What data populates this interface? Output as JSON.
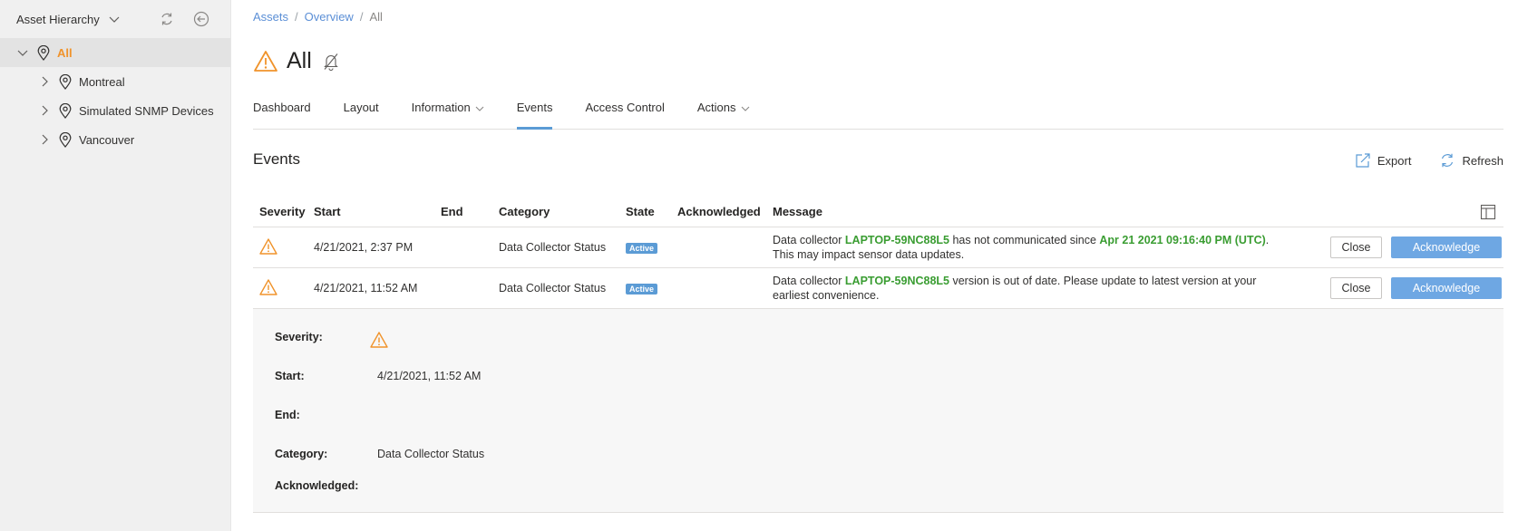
{
  "sidebar": {
    "title": "Asset Hierarchy",
    "tree": [
      {
        "label": "All",
        "selected": true
      },
      {
        "label": "Montreal"
      },
      {
        "label": "Simulated SNMP Devices"
      },
      {
        "label": "Vancouver"
      }
    ]
  },
  "breadcrumb": {
    "items": [
      "Assets",
      "Overview"
    ],
    "sep": "/",
    "current": "All"
  },
  "page": {
    "title": "All"
  },
  "tabs": [
    {
      "label": "Dashboard"
    },
    {
      "label": "Layout"
    },
    {
      "label": "Information",
      "dropdown": true
    },
    {
      "label": "Events",
      "active": true
    },
    {
      "label": "Access Control"
    },
    {
      "label": "Actions",
      "dropdown": true
    }
  ],
  "events": {
    "title": "Events",
    "export_label": "Export",
    "refresh_label": "Refresh",
    "columns": {
      "severity": "Severity",
      "start": "Start",
      "end": "End",
      "category": "Category",
      "state": "State",
      "acknowledged": "Acknowledged",
      "message": "Message"
    },
    "rows": [
      {
        "start": "4/21/2021, 2:37 PM",
        "end": "",
        "category": "Data Collector Status",
        "state": "Active",
        "acknowledged": "",
        "msg_pre": "Data collector ",
        "msg_host": "LAPTOP-59NC88L5",
        "msg_mid": " has not communicated since ",
        "msg_date": "Apr 21 2021 09:16:40 PM (UTC)",
        "msg_post": ".",
        "msg_line2": "This may impact sensor data updates.",
        "close_label": "Close",
        "ack_label": "Acknowledge"
      },
      {
        "start": "4/21/2021, 11:52 AM",
        "end": "",
        "category": "Data Collector Status",
        "state": "Active",
        "acknowledged": "",
        "msg_pre": "Data collector ",
        "msg_host": "LAPTOP-59NC88L5",
        "msg_mid": " version is out of date. Please update to latest version at your",
        "msg_line2": "earliest convenience.",
        "close_label": "Close",
        "ack_label": "Acknowledge"
      }
    ],
    "details": {
      "severity_label": "Severity:",
      "start_label": "Start:",
      "start_value": "4/21/2021, 11:52 AM",
      "end_label": "End:",
      "end_value": "",
      "category_label": "Category:",
      "category_value": "Data Collector Status",
      "acknowledged_label": "Acknowledged:",
      "acknowledged_value": ""
    }
  },
  "colors": {
    "warning": "#f0932b",
    "accent": "#5b9bd5",
    "highlight_green": "#3a9d32",
    "link": "#5b8fd6"
  }
}
